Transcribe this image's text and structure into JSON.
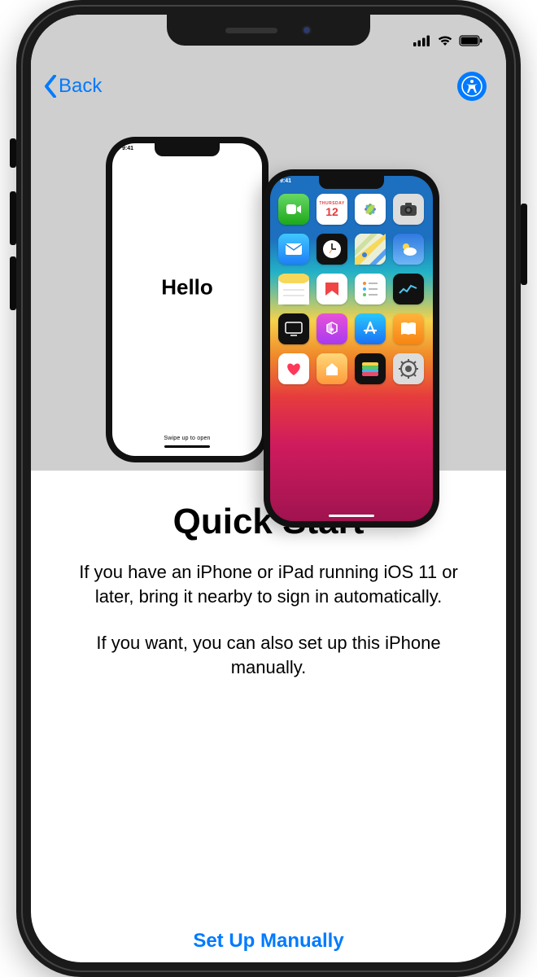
{
  "nav": {
    "back_label": "Back"
  },
  "illustration": {
    "left_phone_text": "Hello",
    "left_phone_swipe": "Swipe up to open",
    "mini_time": "9:41",
    "calendar_day": "12",
    "calendar_weekday": "Thursday"
  },
  "content": {
    "title": "Quick Start",
    "para1": "If you have an iPhone or iPad running iOS 11 or later, bring it nearby to sign in automatically.",
    "para2": "If you want, you can also set up this iPhone manually."
  },
  "action": {
    "manual_label": "Set Up Manually"
  },
  "colors": {
    "accent": "#007aff"
  }
}
